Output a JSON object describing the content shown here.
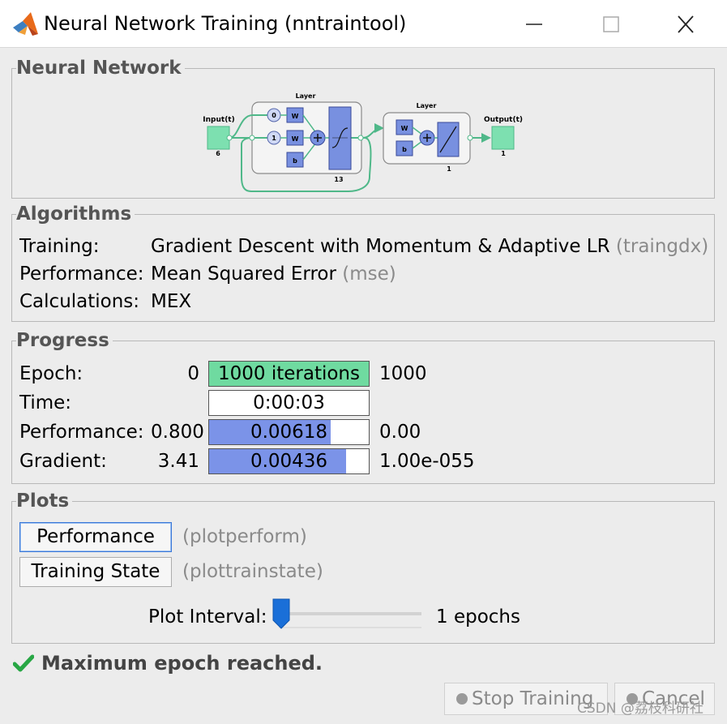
{
  "window": {
    "title": "Neural Network Training (nntraintool)",
    "icon": "matlab-logo-icon",
    "controls": [
      "minimize-icon",
      "maximize-icon",
      "close-icon"
    ]
  },
  "neural_network": {
    "heading": "Neural Network",
    "diagram": {
      "input_label": "Input(t)",
      "input_size": "6",
      "layer1_label": "Layer",
      "layer1_size": "13",
      "delay_top": "0",
      "delay_bottom": "1",
      "weight_label": "W",
      "bias_label": "b",
      "layer2_label": "Layer",
      "layer2_size": "1",
      "output_label": "Output(t)",
      "output_size": "1"
    }
  },
  "algorithms": {
    "heading": "Algorithms",
    "training_label": "Training:",
    "training_value": "Gradient Descent with Momentum & Adaptive LR",
    "training_fn": "(traingdx)",
    "performance_label": "Performance:",
    "performance_value": "Mean Squared Error",
    "performance_fn": "(mse)",
    "calculations_label": "Calculations:",
    "calculations_value": "MEX"
  },
  "progress": {
    "heading": "Progress",
    "rows": [
      {
        "label": "Epoch:",
        "start": "0",
        "value": "1000 iterations",
        "end": "1000",
        "fill": 1.0,
        "color": "#6fdaa0"
      },
      {
        "label": "Time:",
        "start": "",
        "value": "0:00:03",
        "end": "",
        "fill": 0.0,
        "color": "#ffffff"
      },
      {
        "label": "Performance:",
        "start": "0.800",
        "value": "0.00618",
        "end": "0.00",
        "fill": 0.76,
        "color": "#7b93e8"
      },
      {
        "label": "Gradient:",
        "start": "3.41",
        "value": "0.00436",
        "end": "1.00e-055",
        "fill": 0.86,
        "color": "#7b93e8"
      }
    ]
  },
  "plots": {
    "heading": "Plots",
    "buttons": [
      {
        "label": "Performance",
        "fn": "(plotperform)"
      },
      {
        "label": "Training State",
        "fn": "(plottrainstate)"
      }
    ],
    "interval_label": "Plot Interval:",
    "interval_value": "1 epochs"
  },
  "status": {
    "icon": "checkmark-icon",
    "text": "Maximum epoch reached."
  },
  "footer": {
    "stop_label": "Stop Training",
    "cancel_label": "Cancel",
    "watermark": "CSDN @荔枝科研社"
  }
}
